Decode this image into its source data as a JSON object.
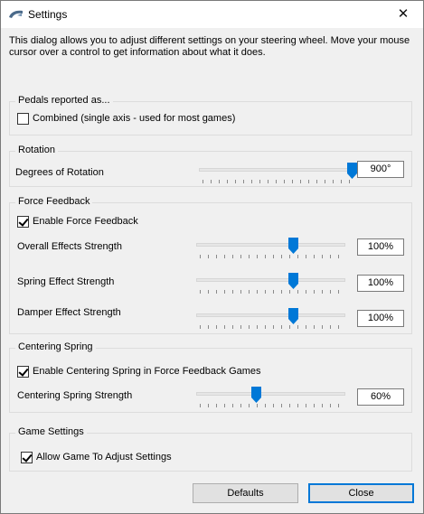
{
  "window": {
    "title": "Settings",
    "close_glyph": "✕",
    "icon": "steering-wheel-icon"
  },
  "intro_text": "This dialog allows you to adjust different settings on your steering wheel.  Move your mouse cursor over a control to get information about what it does.",
  "pedals": {
    "title": "Pedals reported as...",
    "combined": {
      "label": "Combined (single axis - used for most games)",
      "checked": false
    }
  },
  "rotation": {
    "title": "Rotation",
    "degrees": {
      "label": "Degrees of Rotation",
      "value_text": "900°",
      "fraction": 0.98
    }
  },
  "force_feedback": {
    "title": "Force Feedback",
    "enable": {
      "label": "Enable Force Feedback",
      "checked": true
    },
    "overall": {
      "label": "Overall Effects Strength",
      "value_text": "100%",
      "fraction": 0.65
    },
    "spring": {
      "label": "Spring Effect Strength",
      "value_text": "100%",
      "fraction": 0.65
    },
    "damper": {
      "label": "Damper Effect Strength",
      "value_text": "100%",
      "fraction": 0.65
    }
  },
  "centering": {
    "title": "Centering Spring",
    "enable": {
      "label": "Enable Centering Spring in Force Feedback Games",
      "checked": true
    },
    "strength": {
      "label": "Centering Spring Strength",
      "value_text": "60%",
      "fraction": 0.4
    }
  },
  "game": {
    "title": "Game Settings",
    "allow": {
      "label": "Allow Game To Adjust Settings",
      "checked": true
    }
  },
  "buttons": {
    "defaults": "Defaults",
    "close": "Close"
  },
  "colors": {
    "accent": "#0078d7"
  }
}
